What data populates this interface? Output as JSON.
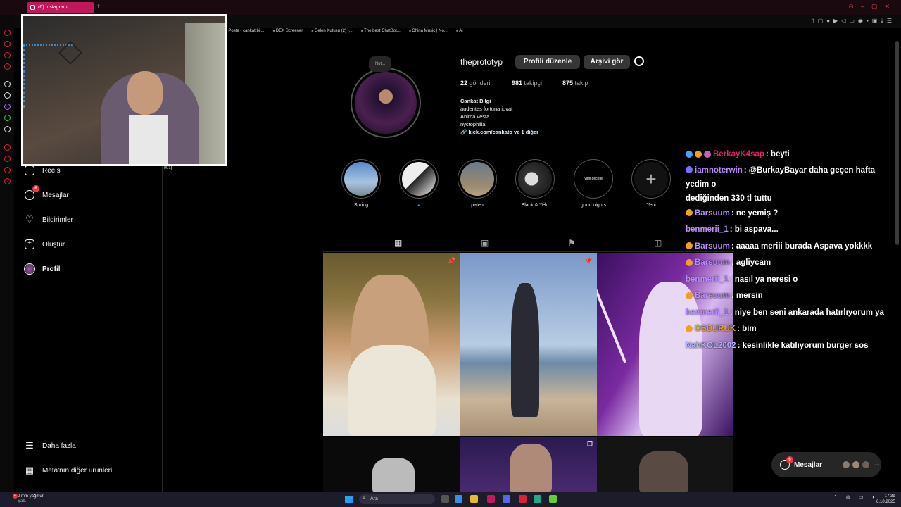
{
  "browser": {
    "tab_title": "(6) Instagram",
    "bookmarks": [
      "Poste - cankat bil...",
      "DEX Screener",
      "Gelen Kutusu (2) -...",
      "The best ChatBot...",
      "China Music | No...",
      "Ai"
    ]
  },
  "sidebar": {
    "items": [
      {
        "label": "Reels",
        "icon": "reels-icon"
      },
      {
        "label": "Mesajlar",
        "icon": "messenger-icon",
        "badge": "6"
      },
      {
        "label": "Bildirimler",
        "icon": "heart-icon"
      },
      {
        "label": "Oluştur",
        "icon": "plus-square-icon"
      },
      {
        "label": "Profil",
        "icon": "avatar-icon"
      }
    ],
    "bottom": [
      {
        "label": "Daha fazla",
        "icon": "menu-icon"
      },
      {
        "label": "Meta'nın diğer ürünleri",
        "icon": "grid-icon"
      }
    ],
    "stream_tag": "[001]"
  },
  "profile": {
    "note": "Not...",
    "username": "theprototyp",
    "edit_button": "Profili düzenle",
    "archive_button": "Arşivi gör",
    "stats": {
      "posts_count": "22",
      "posts_label": "gönderi",
      "followers_count": "981",
      "followers_label": "takipçi",
      "following_count": "875",
      "following_label": "takip"
    },
    "bio": {
      "name": "Cankat Bilgi",
      "lines": [
        "audentes fortuna iuvat",
        "Anima vesta",
        "nyctophilia"
      ],
      "link": "kick.com/cankato ve 1 diğer"
    }
  },
  "highlights": [
    {
      "label": "Spring",
      "inner": ""
    },
    {
      "label": "🔹",
      "inner": ""
    },
    {
      "label": "paten",
      "inner": ""
    },
    {
      "label": "Black & Yelo",
      "inner": ""
    },
    {
      "label": "good nights",
      "inner": "İyimi geceler"
    },
    {
      "label": "Yeni",
      "inner": "+"
    }
  ],
  "chat": [
    {
      "user": "BerkayK4sap",
      "color": "#e0245e",
      "text": ": beyti",
      "badges": [
        "#4aa0ff",
        "#f0a020",
        "#c060c0"
      ]
    },
    {
      "user": "iamnoterwin",
      "color": "#b98cff",
      "text": ": @BurkayBayar daha geçen hafta yedim o",
      "badges": [
        "#7a6cff"
      ]
    },
    {
      "user": "",
      "color": "#fff",
      "text": "dediğinden 330 tl tuttu",
      "badges": []
    },
    {
      "user": "Barsuum",
      "color": "#b98cff",
      "text": ": ne yemiş ?",
      "badges": [
        "#f0a020"
      ]
    },
    {
      "user": "benmerii_1",
      "color": "#b98cff",
      "text": ": bi aspava...",
      "badges": []
    },
    {
      "user": "Barsuum",
      "color": "#b98cff",
      "text": ": aaaaa meriii burada Aspava yokkkk",
      "badges": [
        "#f0a020"
      ]
    },
    {
      "user": "Barsuum",
      "color": "#b98cff",
      "text": ": agliycam",
      "badges": [
        "#f0a020"
      ]
    },
    {
      "user": "benmerii_1",
      "color": "#b98cff",
      "text": ": nasıl ya neresi o",
      "badges": []
    },
    {
      "user": "Barsuum",
      "color": "#b98cff",
      "text": ": mersin",
      "badges": [
        "#f0a020"
      ]
    },
    {
      "user": "benmerii_1",
      "color": "#b98cff",
      "text": ": niye ben seni ankarada hatırlıyorum ya",
      "badges": []
    },
    {
      "user": "OSDURUK",
      "color": "#f0a020",
      "text": ": bim",
      "badges": [
        "#f0a020"
      ]
    },
    {
      "user": "NahKOL2002",
      "color": "#b0b0ff",
      "text": ": kesinlikle katılıyorum burger sos",
      "badges": []
    }
  ],
  "messages_pill": {
    "label": "Mesajlar",
    "badge": "6"
  },
  "taskbar": {
    "weather_badge": "4",
    "weather_line1": "2 mm yağmur",
    "weather_line2": "Şab.",
    "search_placeholder": "Ara",
    "time": "17:39",
    "date": "6.10.2025"
  }
}
